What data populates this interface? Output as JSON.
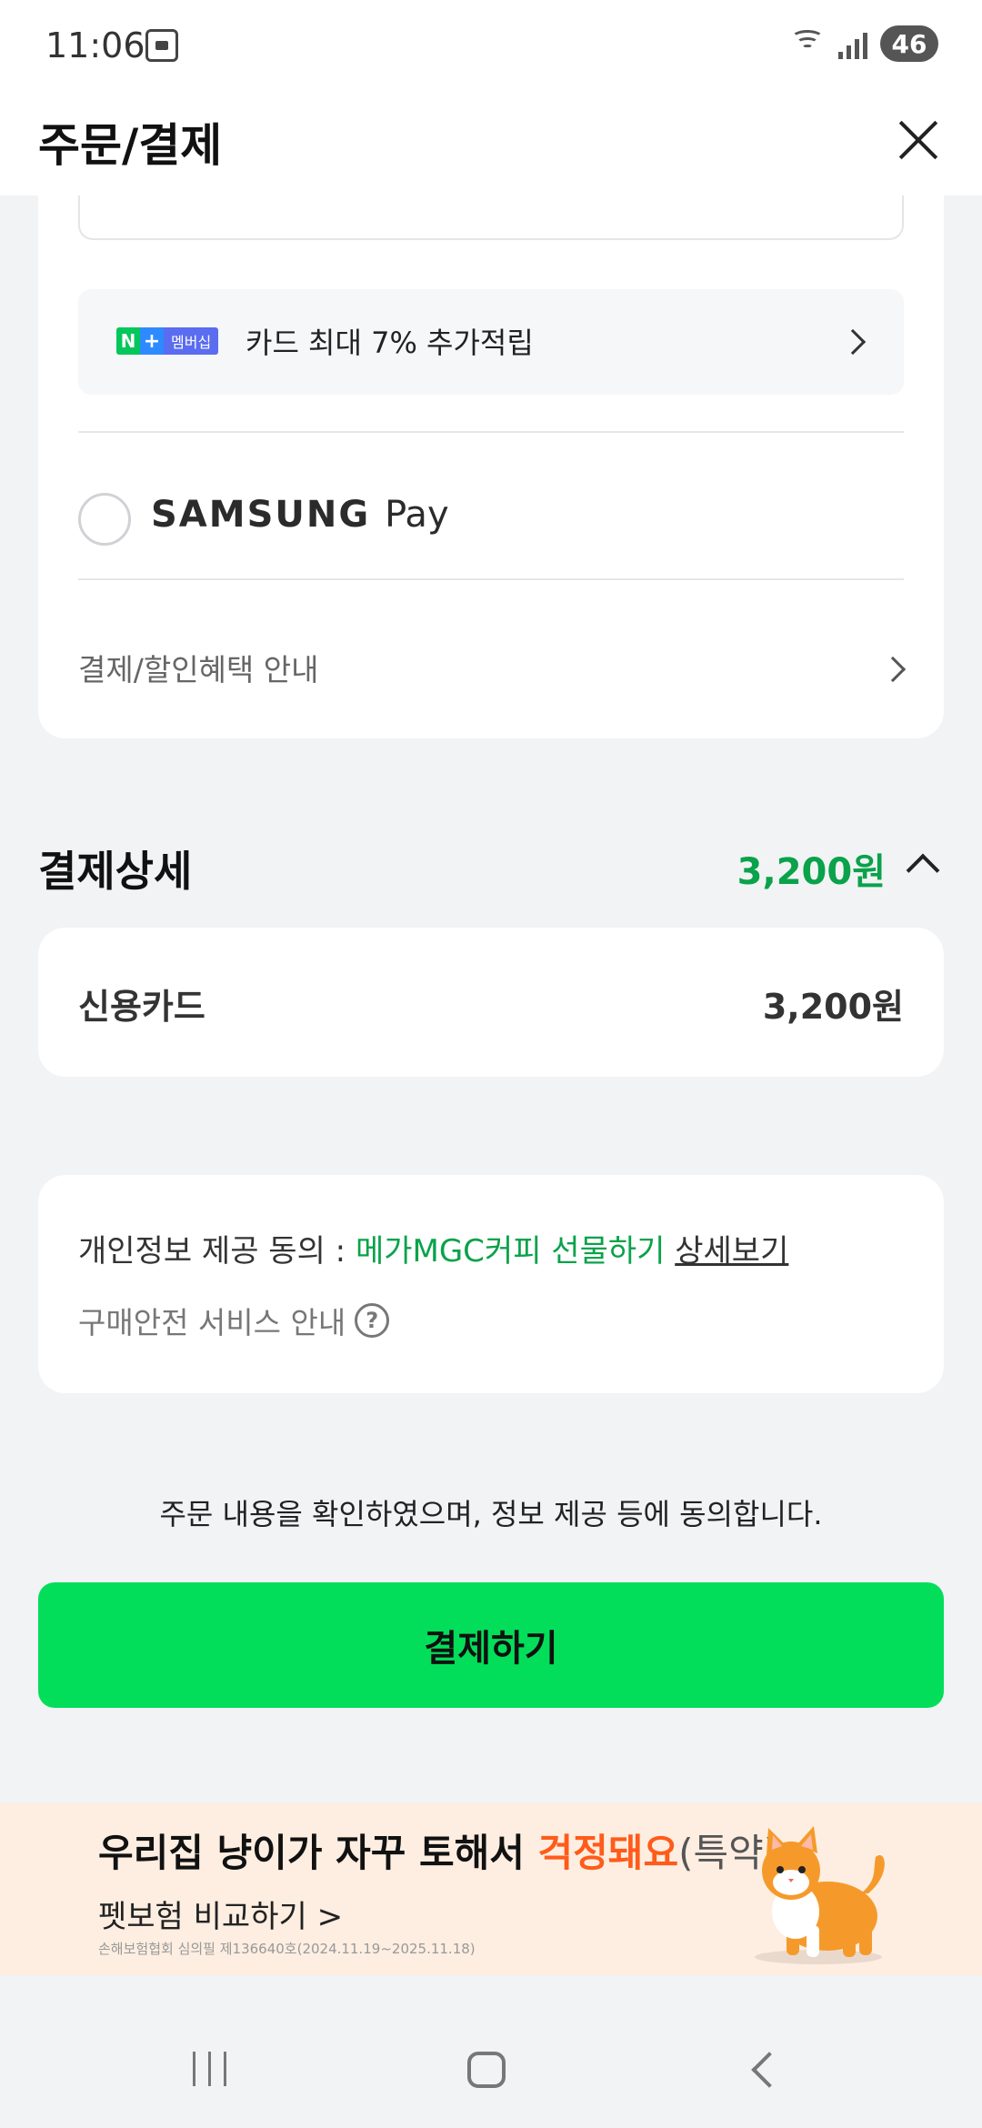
{
  "status_bar": {
    "time": "11:06",
    "battery": "46"
  },
  "header": {
    "title": "주문/결제"
  },
  "payment_methods": {
    "clipped_input_text": "",
    "npay_banner": {
      "badge_n": "N",
      "badge_plus": "+",
      "badge_member": "멤버십",
      "text": "카드 최대 7% 추가적립"
    },
    "samsung_pay": {
      "brand": "SAMSUNG",
      "pay": "Pay"
    },
    "benefit_link": "결제/할인혜택 안내"
  },
  "payment_detail": {
    "title": "결제상세",
    "total": "3,200원",
    "items": [
      {
        "label": "신용카드",
        "value": "3,200원"
      }
    ]
  },
  "consent": {
    "prefix": "개인정보 제공 동의 : ",
    "company": "메가MGC커피 선물하기",
    "detail_link": "상세보기",
    "safety": "구매안전 서비스 안내",
    "help_icon": "?"
  },
  "agree_text": "주문 내용을 확인하였으며, 정보 제공 등에 동의합니다.",
  "pay_button": "결제하기",
  "ad": {
    "headline_main": "우리집 냥이가 자꾸 토해서 ",
    "headline_highlight": "걱정돼요",
    "headline_tail": "(특약)",
    "sub": "펫보험 비교하기 >",
    "fine_print": "손해보험협회 심의필 제136640호(2024.11.19~2025.11.18)"
  },
  "colors": {
    "accent_green": "#0aa24a",
    "button_green": "#03de5a",
    "ad_orange": "#ff5b1a"
  }
}
